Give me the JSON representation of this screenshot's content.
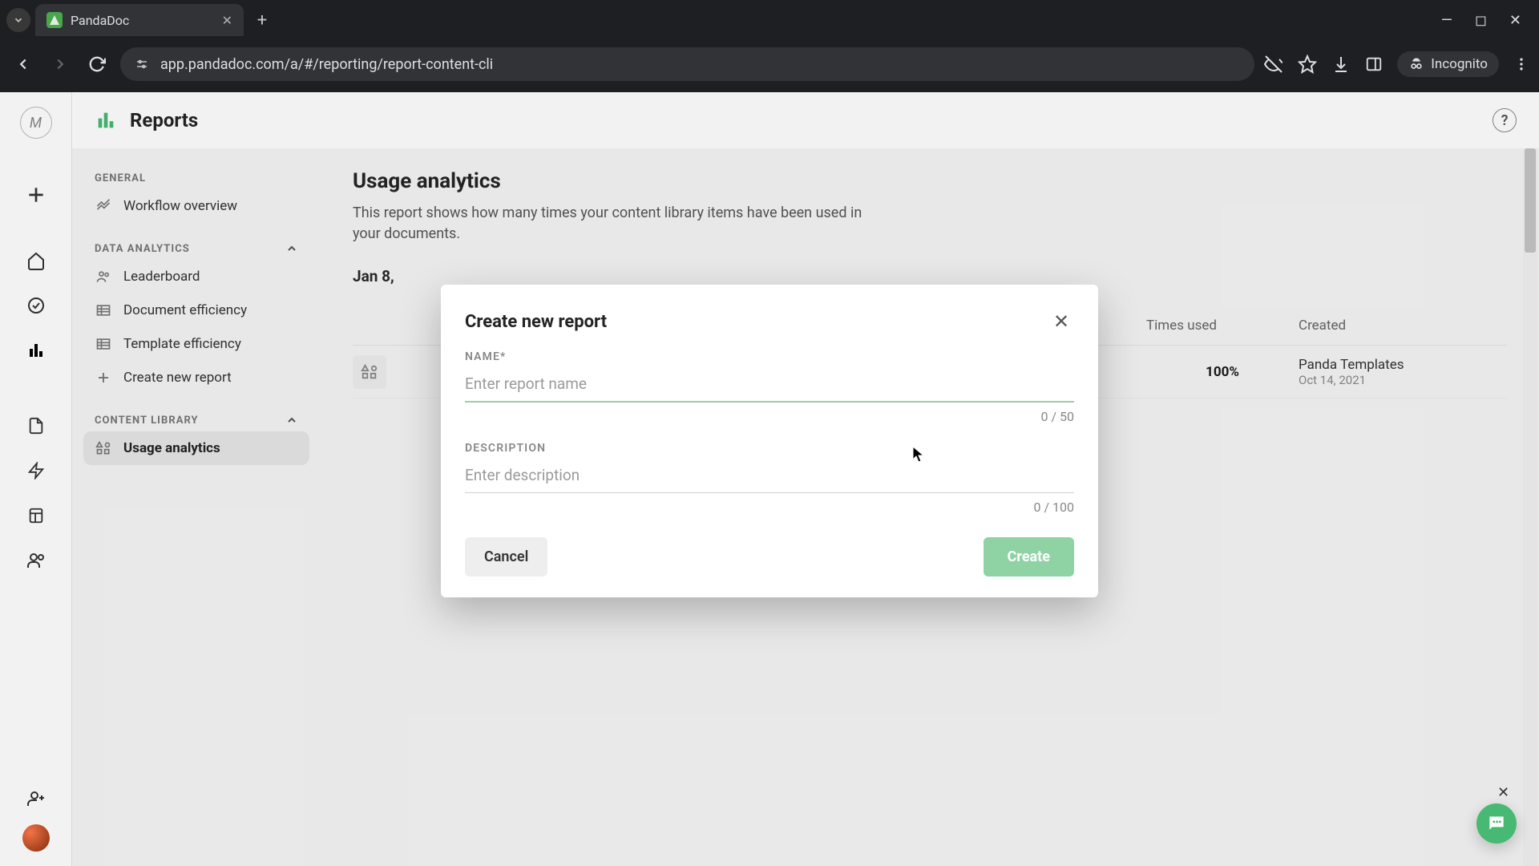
{
  "browser": {
    "tab_title": "PandaDoc",
    "url": "app.pandadoc.com/a/#/reporting/report-content-cli",
    "incognito_label": "Incognito"
  },
  "header": {
    "title": "Reports"
  },
  "sidebar": {
    "sections": {
      "general": {
        "label": "GENERAL"
      },
      "data_analytics": {
        "label": "DATA ANALYTICS"
      },
      "content_library": {
        "label": "CONTENT LIBRARY"
      }
    },
    "items": {
      "workflow": "Workflow overview",
      "leaderboard": "Leaderboard",
      "doc_eff": "Document efficiency",
      "tmpl_eff": "Template efficiency",
      "create_report": "Create new report",
      "usage": "Usage analytics"
    }
  },
  "main": {
    "title": "Usage analytics",
    "desc": "This report shows how many times your content library items have been used in your documents.",
    "date_range": "Jan 8,",
    "columns": {
      "times_used": "Times used",
      "created": "Created"
    },
    "row1": {
      "percent": "100%",
      "creator": "Panda Templates",
      "date": "Oct 14, 2021"
    }
  },
  "modal": {
    "title": "Create new report",
    "name_label": "NAME*",
    "name_placeholder": "Enter report name",
    "name_counter": "0 / 50",
    "desc_label": "DESCRIPTION",
    "desc_placeholder": "Enter description",
    "desc_counter": "0 / 100",
    "cancel": "Cancel",
    "create": "Create"
  }
}
